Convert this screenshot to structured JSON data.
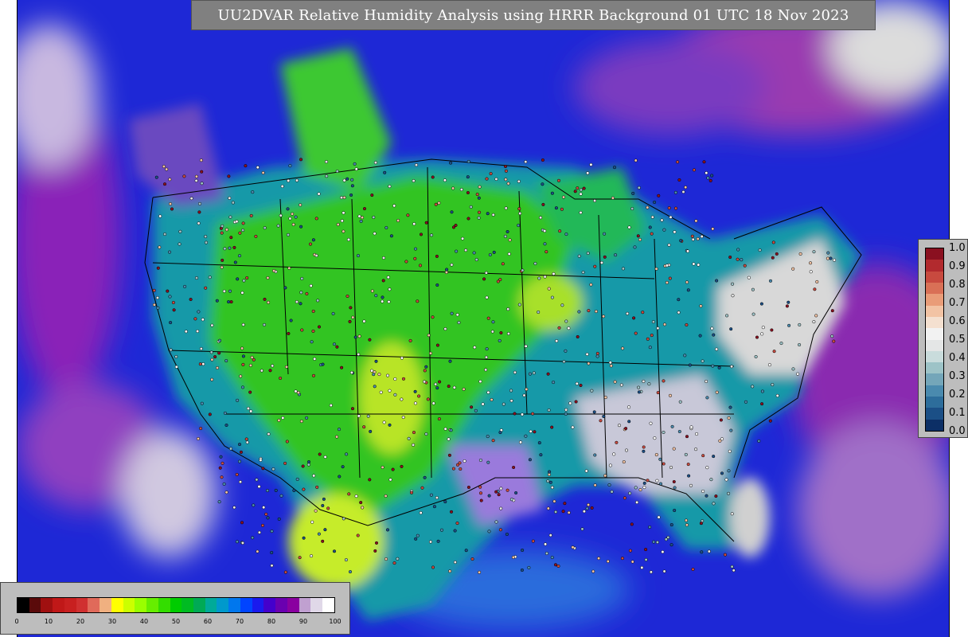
{
  "title": "UU2DVAR Relative Humidity Analysis using HRRR Background 01 UTC 18 Nov 2023",
  "obs_legend": {
    "ticks": [
      "1.0",
      "0.9",
      "0.8",
      "0.7",
      "0.6",
      "0.5",
      "0.4",
      "0.3",
      "0.2",
      "0.1",
      "0.0"
    ],
    "colors": [
      "#0c2f66",
      "#1b4f86",
      "#2d6d9b",
      "#4a8aae",
      "#74a6b9",
      "#9dc3c7",
      "#c9dcdc",
      "#e4e6e6",
      "#f2f2f2",
      "#f4e0d0",
      "#f2c3a4",
      "#e99c78",
      "#d97056",
      "#c84a3f",
      "#b22a2e",
      "#8a1020"
    ]
  },
  "rh_legend": {
    "ticks": [
      "0",
      "10",
      "20",
      "30",
      "40",
      "50",
      "60",
      "70",
      "80",
      "90",
      "100"
    ],
    "colors": [
      "#000000",
      "#5a0a0a",
      "#a01010",
      "#c01818",
      "#c82020",
      "#d03030",
      "#e06a5a",
      "#f0b080",
      "#ffff00",
      "#ccff00",
      "#99ff00",
      "#66ee00",
      "#33dd00",
      "#00cc00",
      "#00bb22",
      "#00aa55",
      "#00aa99",
      "#0099cc",
      "#0077ee",
      "#0044ff",
      "#1a1aee",
      "#4400cc",
      "#6a00b0",
      "#8a00a0",
      "#c0a0d0",
      "#e0d8e8",
      "#ffffff"
    ]
  },
  "map": {
    "ocean_color": "#1e28d6",
    "land_low_rh": "#33cc22",
    "land_mid_rh": "#1199aa",
    "land_high_rh": "#d8d8d8"
  }
}
